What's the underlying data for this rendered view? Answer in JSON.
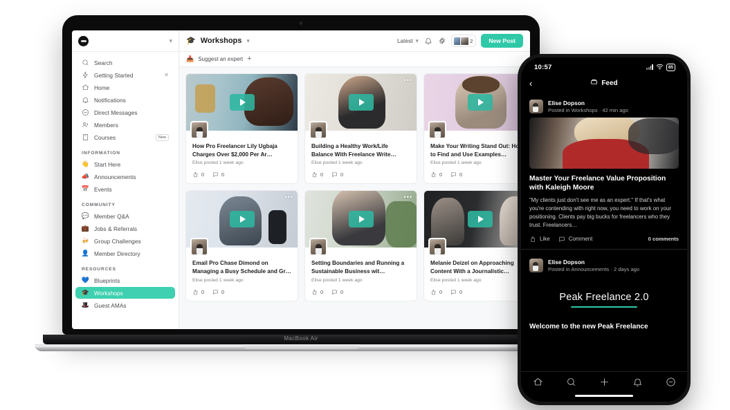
{
  "laptop": {
    "model_label": "MacBook Air",
    "sidebar": {
      "workspace_chevron": "chevron-down",
      "primary": [
        {
          "label": "Search",
          "icon": "search-icon",
          "tail": ""
        },
        {
          "label": "Getting Started",
          "icon": "spark-icon",
          "tail": "close"
        },
        {
          "label": "Home",
          "icon": "home-icon",
          "tail": ""
        },
        {
          "label": "Notifications",
          "icon": "bell-icon",
          "tail": ""
        },
        {
          "label": "Direct Messages",
          "icon": "message-icon",
          "tail": ""
        },
        {
          "label": "Members",
          "icon": "members-icon",
          "tail": ""
        },
        {
          "label": "Courses",
          "icon": "courses-icon",
          "tail": "New"
        }
      ],
      "sections": [
        {
          "title": "INFORMATION",
          "items": [
            {
              "label": "Start Here",
              "emoji": "👋"
            },
            {
              "label": "Announcements",
              "emoji": "📣"
            },
            {
              "label": "Events",
              "emoji": "📅"
            }
          ]
        },
        {
          "title": "COMMUNITY",
          "items": [
            {
              "label": "Member Q&A",
              "emoji": "💬"
            },
            {
              "label": "Jobs & Referrals",
              "emoji": "💼"
            },
            {
              "label": "Group Challenges",
              "emoji": "🍻"
            },
            {
              "label": "Member Directory",
              "emoji": "👤"
            }
          ]
        },
        {
          "title": "RESOURCES",
          "items": [
            {
              "label": "Blueprints",
              "emoji": "💙"
            },
            {
              "label": "Workshops",
              "emoji": "🎓",
              "active": true
            },
            {
              "label": "Guest AMAs",
              "emoji": "🎩"
            }
          ]
        }
      ]
    },
    "topbar": {
      "title": "Workshops",
      "title_icon": "graduation-cap-icon",
      "title_chevron": "chevron-down",
      "sort_label": "Latest",
      "bell_icon": "bell-icon",
      "settings_icon": "gear-icon",
      "online_count": "2",
      "new_post_label": "New Post"
    },
    "subbar": {
      "suggest_label": "Suggest an expert",
      "suggest_icon": "inbox-icon",
      "add_icon": "plus-icon"
    },
    "cards": [
      {
        "title": "How Pro Freelancer Lily Ugbaja Charges Over $2,000 Per Ar…",
        "meta": "Elise posted 1 week ago",
        "likes": "0",
        "comments": "0",
        "thumb_class": "t1",
        "menu": false
      },
      {
        "title": "Building a Healthy Work/Life Balance With Freelance Write…",
        "meta": "Elise posted 1 week ago",
        "likes": "0",
        "comments": "0",
        "thumb_class": "t2",
        "menu": true
      },
      {
        "title": "Make Your Writing Stand Out: How to Find and Use Examples…",
        "meta": "Elise posted 1 week ago",
        "likes": "0",
        "comments": "0",
        "thumb_class": "t3",
        "menu": true
      },
      {
        "title": "Email Pro Chase Dimond on Managing a Busy Schedule and Gr…",
        "meta": "Elise posted 1 week ago",
        "likes": "0",
        "comments": "0",
        "thumb_class": "t4",
        "menu": true
      },
      {
        "title": "Setting Boundaries and Running a Sustainable Business wit…",
        "meta": "Elise posted 1 week ago",
        "likes": "0",
        "comments": "0",
        "thumb_class": "t5",
        "menu": true
      },
      {
        "title": "Melanie Deizel on Approaching Content With a Journalistic…",
        "meta": "Elise posted 1 week ago",
        "likes": "0",
        "comments": "0",
        "thumb_class": "t6",
        "menu": false
      }
    ]
  },
  "phone": {
    "status": {
      "time": "10:57",
      "battery": "85",
      "wifi_icon": "wifi-icon",
      "signal_icon": "cellular-icon"
    },
    "header": {
      "title": "Feed",
      "title_icon": "feed-icon",
      "back_icon": "chevron-left-icon"
    },
    "posts": [
      {
        "author": "Elise Dopson",
        "meta": "Posted in Workshops · 42 min ago",
        "title": "Master Your Freelance Value Proposition with Kaleigh Moore",
        "body": "\"My clients just don't see me as an expert.\" If that's what you're contending with right now, you need to work on your positioning. Clients pay big bucks for freelancers who they trust. Freelancers…",
        "like_label": "Like",
        "comment_label": "Comment",
        "comment_count": "0 comments"
      },
      {
        "author": "Elise Dopson",
        "meta": "Posted in Announcements · 2 days ago",
        "promo_title": "Peak Freelance 2.0",
        "promo_sub": "Welcome to the new Peak Freelance"
      }
    ],
    "tabs": [
      {
        "name": "home-icon"
      },
      {
        "name": "search-icon"
      },
      {
        "name": "plus-icon"
      },
      {
        "name": "bell-icon"
      },
      {
        "name": "message-icon"
      }
    ]
  },
  "colors": {
    "accent": "#2fc9a8",
    "sidebar_active": "#3ed0b0",
    "canvas": "#f6f8f9"
  }
}
